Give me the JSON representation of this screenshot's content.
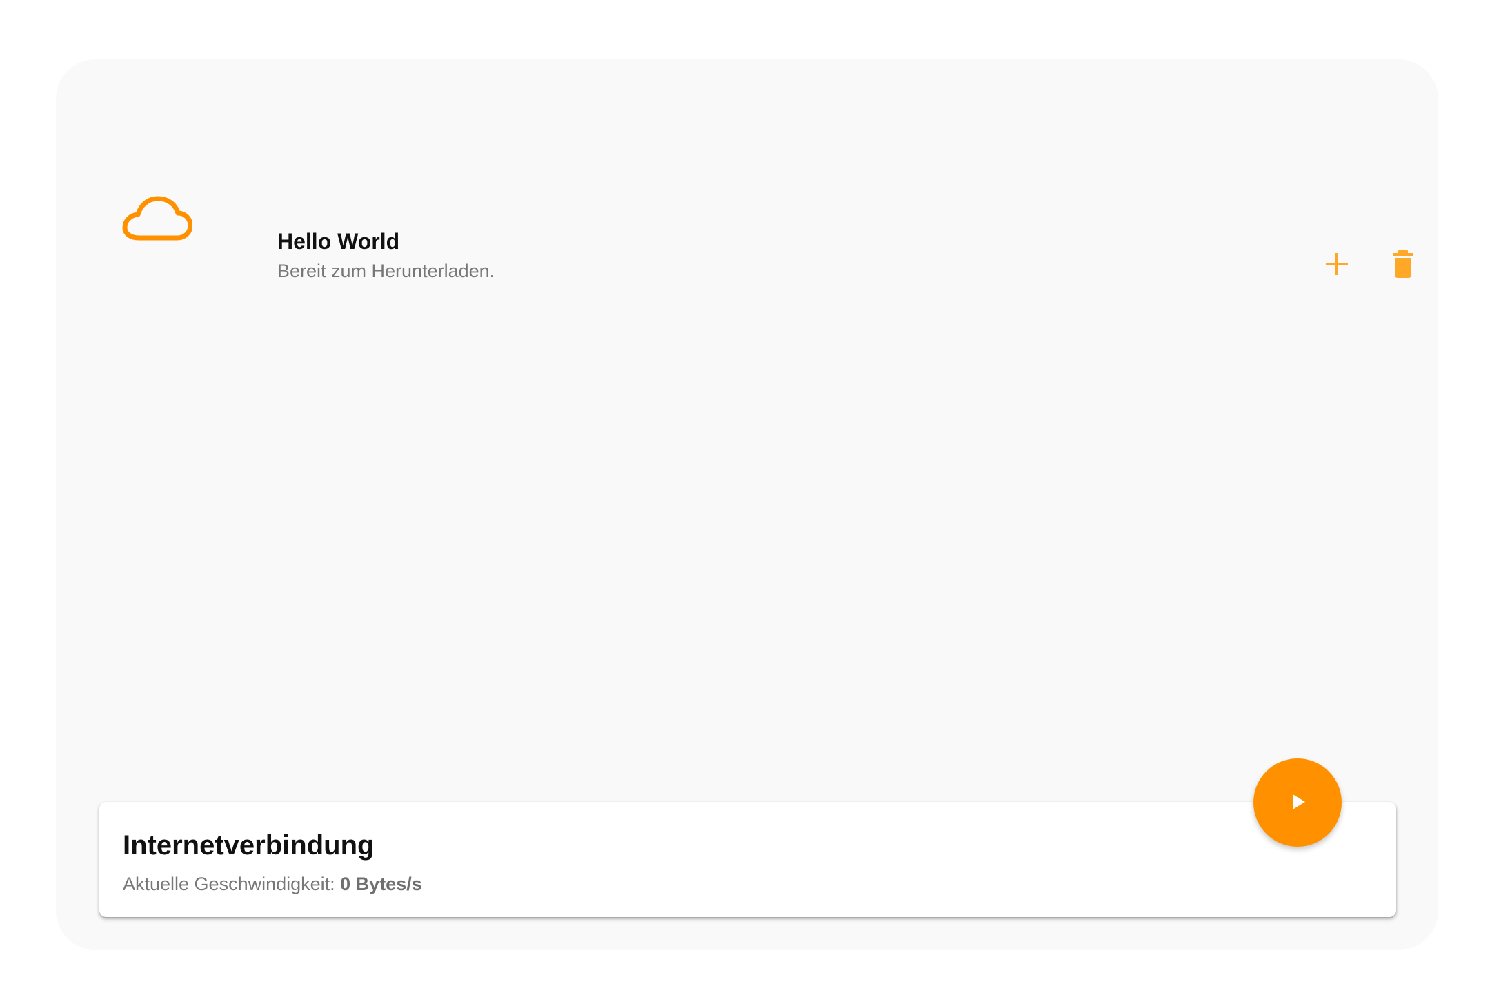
{
  "theme": {
    "accent_color": "#ff9100",
    "light_accent_color": "#ffa726",
    "panel_background": "#f9f9f9",
    "card_background": "#ffffff"
  },
  "download_item": {
    "icon": "cloud-icon",
    "title": "Hello World",
    "subtitle": "Bereit zum Herunterladen.",
    "actions": [
      {
        "icon": "plus-icon"
      },
      {
        "icon": "trash-icon"
      }
    ]
  },
  "connection": {
    "title": "Internetverbindung",
    "speed_label": "Aktuelle Geschwindigkeit: ",
    "speed_value": "0 Bytes/s"
  },
  "fab": {
    "icon": "play-icon"
  }
}
